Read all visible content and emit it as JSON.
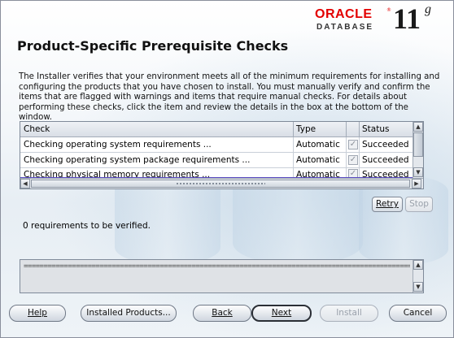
{
  "branding": {
    "oracle": "ORACLE",
    "reg": "®",
    "database": "DATABASE",
    "version": "11",
    "version_suffix": "g"
  },
  "page": {
    "title": "Product-Specific Prerequisite Checks",
    "description": "The Installer verifies that your environment meets all of the minimum requirements for installing and configuring the products that you have chosen to install. You must manually verify and confirm the items that are flagged with warnings and items that require manual checks. For details about performing these checks, click the item and review the details in the box at the bottom of the window."
  },
  "table": {
    "columns": [
      "Check",
      "Type",
      "Status"
    ],
    "rows": [
      {
        "check": "Checking operating system requirements ...",
        "type": "Automatic",
        "checked": true,
        "status": "Succeeded"
      },
      {
        "check": "Checking operating system package requirements ...",
        "type": "Automatic",
        "checked": true,
        "status": "Succeeded"
      },
      {
        "check": "Checking physical memory requirements ...",
        "type": "Automatic",
        "checked": true,
        "status": "Succeeded"
      }
    ]
  },
  "actions": {
    "retry": "Retry",
    "stop": "Stop"
  },
  "status": {
    "message": "0 requirements to be verified."
  },
  "details": {
    "text": "==============================================================================================================================="
  },
  "footer": {
    "help": "Help",
    "installed_products": "Installed Products...",
    "back": "Back",
    "next": "Next",
    "install": "Install",
    "cancel": "Cancel"
  },
  "icons": {
    "check": "✓",
    "arrow_up": "▲",
    "arrow_down": "▼",
    "arrow_left": "◀",
    "arrow_right": "▶"
  }
}
